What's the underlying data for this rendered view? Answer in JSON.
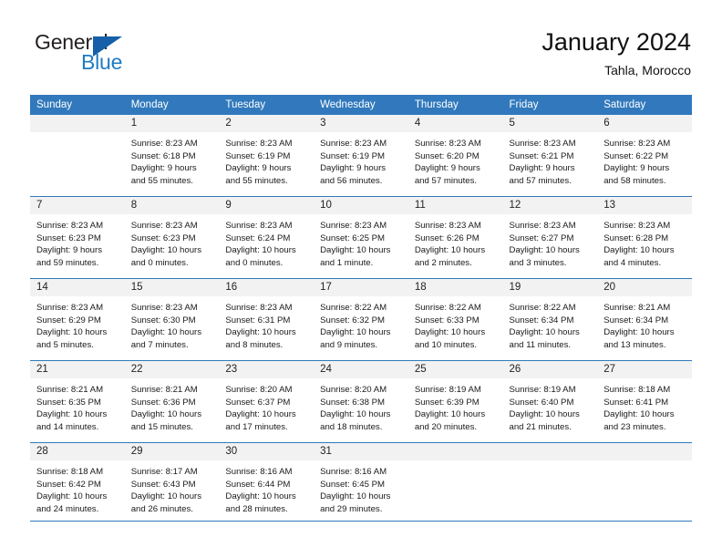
{
  "brand": {
    "name_top": "General",
    "name_bottom": "Blue",
    "accent_color": "#1560a8",
    "blue_text_color": "#1e7bc4"
  },
  "header": {
    "title": "January 2024",
    "location": "Tahla, Morocco"
  },
  "theme": {
    "header_row_bg": "#3179bc",
    "daynum_bg": "#f2f2f2",
    "rule_color": "#3179bc"
  },
  "weekday_headers": [
    "Sunday",
    "Monday",
    "Tuesday",
    "Wednesday",
    "Thursday",
    "Friday",
    "Saturday"
  ],
  "weeks": [
    [
      {
        "day": "",
        "l1": "",
        "l2": "",
        "l3": "",
        "l4": "",
        "empty": true
      },
      {
        "day": "1",
        "l1": "Sunrise: 8:23 AM",
        "l2": "Sunset: 6:18 PM",
        "l3": "Daylight: 9 hours",
        "l4": "and 55 minutes."
      },
      {
        "day": "2",
        "l1": "Sunrise: 8:23 AM",
        "l2": "Sunset: 6:19 PM",
        "l3": "Daylight: 9 hours",
        "l4": "and 55 minutes."
      },
      {
        "day": "3",
        "l1": "Sunrise: 8:23 AM",
        "l2": "Sunset: 6:19 PM",
        "l3": "Daylight: 9 hours",
        "l4": "and 56 minutes."
      },
      {
        "day": "4",
        "l1": "Sunrise: 8:23 AM",
        "l2": "Sunset: 6:20 PM",
        "l3": "Daylight: 9 hours",
        "l4": "and 57 minutes."
      },
      {
        "day": "5",
        "l1": "Sunrise: 8:23 AM",
        "l2": "Sunset: 6:21 PM",
        "l3": "Daylight: 9 hours",
        "l4": "and 57 minutes."
      },
      {
        "day": "6",
        "l1": "Sunrise: 8:23 AM",
        "l2": "Sunset: 6:22 PM",
        "l3": "Daylight: 9 hours",
        "l4": "and 58 minutes."
      }
    ],
    [
      {
        "day": "7",
        "l1": "Sunrise: 8:23 AM",
        "l2": "Sunset: 6:23 PM",
        "l3": "Daylight: 9 hours",
        "l4": "and 59 minutes."
      },
      {
        "day": "8",
        "l1": "Sunrise: 8:23 AM",
        "l2": "Sunset: 6:23 PM",
        "l3": "Daylight: 10 hours",
        "l4": "and 0 minutes."
      },
      {
        "day": "9",
        "l1": "Sunrise: 8:23 AM",
        "l2": "Sunset: 6:24 PM",
        "l3": "Daylight: 10 hours",
        "l4": "and 0 minutes."
      },
      {
        "day": "10",
        "l1": "Sunrise: 8:23 AM",
        "l2": "Sunset: 6:25 PM",
        "l3": "Daylight: 10 hours",
        "l4": "and 1 minute."
      },
      {
        "day": "11",
        "l1": "Sunrise: 8:23 AM",
        "l2": "Sunset: 6:26 PM",
        "l3": "Daylight: 10 hours",
        "l4": "and 2 minutes."
      },
      {
        "day": "12",
        "l1": "Sunrise: 8:23 AM",
        "l2": "Sunset: 6:27 PM",
        "l3": "Daylight: 10 hours",
        "l4": "and 3 minutes."
      },
      {
        "day": "13",
        "l1": "Sunrise: 8:23 AM",
        "l2": "Sunset: 6:28 PM",
        "l3": "Daylight: 10 hours",
        "l4": "and 4 minutes."
      }
    ],
    [
      {
        "day": "14",
        "l1": "Sunrise: 8:23 AM",
        "l2": "Sunset: 6:29 PM",
        "l3": "Daylight: 10 hours",
        "l4": "and 5 minutes."
      },
      {
        "day": "15",
        "l1": "Sunrise: 8:23 AM",
        "l2": "Sunset: 6:30 PM",
        "l3": "Daylight: 10 hours",
        "l4": "and 7 minutes."
      },
      {
        "day": "16",
        "l1": "Sunrise: 8:23 AM",
        "l2": "Sunset: 6:31 PM",
        "l3": "Daylight: 10 hours",
        "l4": "and 8 minutes."
      },
      {
        "day": "17",
        "l1": "Sunrise: 8:22 AM",
        "l2": "Sunset: 6:32 PM",
        "l3": "Daylight: 10 hours",
        "l4": "and 9 minutes."
      },
      {
        "day": "18",
        "l1": "Sunrise: 8:22 AM",
        "l2": "Sunset: 6:33 PM",
        "l3": "Daylight: 10 hours",
        "l4": "and 10 minutes."
      },
      {
        "day": "19",
        "l1": "Sunrise: 8:22 AM",
        "l2": "Sunset: 6:34 PM",
        "l3": "Daylight: 10 hours",
        "l4": "and 11 minutes."
      },
      {
        "day": "20",
        "l1": "Sunrise: 8:21 AM",
        "l2": "Sunset: 6:34 PM",
        "l3": "Daylight: 10 hours",
        "l4": "and 13 minutes."
      }
    ],
    [
      {
        "day": "21",
        "l1": "Sunrise: 8:21 AM",
        "l2": "Sunset: 6:35 PM",
        "l3": "Daylight: 10 hours",
        "l4": "and 14 minutes."
      },
      {
        "day": "22",
        "l1": "Sunrise: 8:21 AM",
        "l2": "Sunset: 6:36 PM",
        "l3": "Daylight: 10 hours",
        "l4": "and 15 minutes."
      },
      {
        "day": "23",
        "l1": "Sunrise: 8:20 AM",
        "l2": "Sunset: 6:37 PM",
        "l3": "Daylight: 10 hours",
        "l4": "and 17 minutes."
      },
      {
        "day": "24",
        "l1": "Sunrise: 8:20 AM",
        "l2": "Sunset: 6:38 PM",
        "l3": "Daylight: 10 hours",
        "l4": "and 18 minutes."
      },
      {
        "day": "25",
        "l1": "Sunrise: 8:19 AM",
        "l2": "Sunset: 6:39 PM",
        "l3": "Daylight: 10 hours",
        "l4": "and 20 minutes."
      },
      {
        "day": "26",
        "l1": "Sunrise: 8:19 AM",
        "l2": "Sunset: 6:40 PM",
        "l3": "Daylight: 10 hours",
        "l4": "and 21 minutes."
      },
      {
        "day": "27",
        "l1": "Sunrise: 8:18 AM",
        "l2": "Sunset: 6:41 PM",
        "l3": "Daylight: 10 hours",
        "l4": "and 23 minutes."
      }
    ],
    [
      {
        "day": "28",
        "l1": "Sunrise: 8:18 AM",
        "l2": "Sunset: 6:42 PM",
        "l3": "Daylight: 10 hours",
        "l4": "and 24 minutes."
      },
      {
        "day": "29",
        "l1": "Sunrise: 8:17 AM",
        "l2": "Sunset: 6:43 PM",
        "l3": "Daylight: 10 hours",
        "l4": "and 26 minutes."
      },
      {
        "day": "30",
        "l1": "Sunrise: 8:16 AM",
        "l2": "Sunset: 6:44 PM",
        "l3": "Daylight: 10 hours",
        "l4": "and 28 minutes."
      },
      {
        "day": "31",
        "l1": "Sunrise: 8:16 AM",
        "l2": "Sunset: 6:45 PM",
        "l3": "Daylight: 10 hours",
        "l4": "and 29 minutes."
      },
      {
        "day": "",
        "l1": "",
        "l2": "",
        "l3": "",
        "l4": "",
        "empty": true
      },
      {
        "day": "",
        "l1": "",
        "l2": "",
        "l3": "",
        "l4": "",
        "empty": true
      },
      {
        "day": "",
        "l1": "",
        "l2": "",
        "l3": "",
        "l4": "",
        "empty": true
      }
    ]
  ]
}
